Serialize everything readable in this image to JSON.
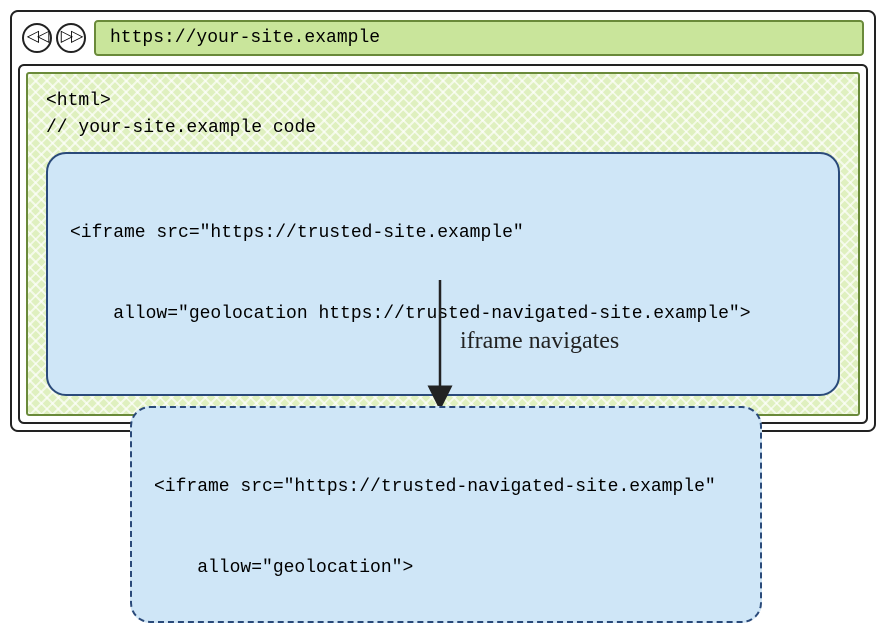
{
  "browser": {
    "back_icon": "◁◁",
    "forward_icon": "▷▷",
    "url": "https://your-site.example"
  },
  "page_code": {
    "line1": "<html>",
    "line2": "// your-site.example code"
  },
  "iframe1": {
    "line1": "<iframe src=\"https://trusted-site.example\"",
    "line2": "    allow=\"geolocation https://trusted-navigated-site.example\">"
  },
  "annotation": "iframe navigates",
  "iframe2": {
    "line1": "<iframe src=\"https://trusted-navigated-site.example\"",
    "line2": "    allow=\"geolocation\">"
  }
}
